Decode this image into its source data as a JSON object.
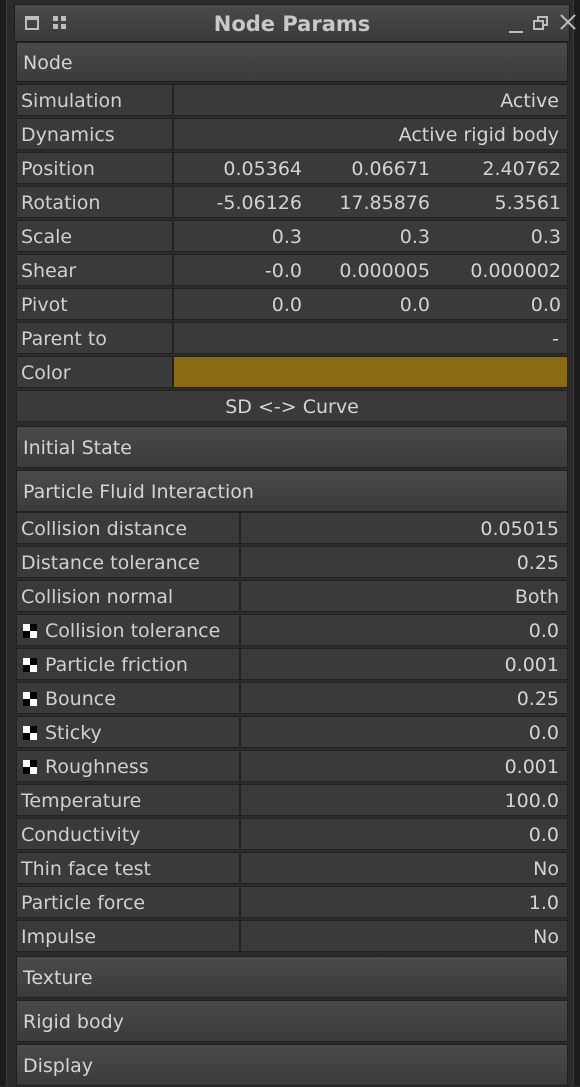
{
  "panel": {
    "title": "Node Params"
  },
  "sections": {
    "node": "Node",
    "initial_state": "Initial State",
    "particle_fluid_interaction": "Particle Fluid Interaction",
    "texture": "Texture",
    "rigid_body": "Rigid body",
    "display": "Display"
  },
  "node": {
    "simulation": {
      "label": "Simulation",
      "value": "Active"
    },
    "dynamics": {
      "label": "Dynamics",
      "value": "Active rigid body"
    },
    "position": {
      "label": "Position",
      "x": "0.05364",
      "y": "0.06671",
      "z": "2.40762"
    },
    "rotation": {
      "label": "Rotation",
      "x": "-5.06126",
      "y": "17.85876",
      "z": "5.3561"
    },
    "scale": {
      "label": "Scale",
      "x": "0.3",
      "y": "0.3",
      "z": "0.3"
    },
    "shear": {
      "label": "Shear",
      "x": "-0.0",
      "y": "0.000005",
      "z": "0.000002"
    },
    "pivot": {
      "label": "Pivot",
      "x": "0.0",
      "y": "0.0",
      "z": "0.0"
    },
    "parent_to": {
      "label": "Parent to",
      "value": "-"
    },
    "color": {
      "label": "Color",
      "hex": "#8a6a12"
    },
    "sd_curve_button": "SD <-> Curve"
  },
  "pfi": {
    "collision_distance": {
      "label": "Collision distance",
      "value": "0.05015"
    },
    "distance_tolerance": {
      "label": "Distance tolerance",
      "value": "0.25"
    },
    "collision_normal": {
      "label": "Collision normal",
      "value": "Both"
    },
    "collision_tolerance": {
      "label": "Collision tolerance",
      "value": "0.0"
    },
    "particle_friction": {
      "label": "Particle friction",
      "value": "0.001"
    },
    "bounce": {
      "label": "Bounce",
      "value": "0.25"
    },
    "sticky": {
      "label": "Sticky",
      "value": "0.0"
    },
    "roughness": {
      "label": "Roughness",
      "value": "0.001"
    },
    "temperature": {
      "label": "Temperature",
      "value": "100.0"
    },
    "conductivity": {
      "label": "Conductivity",
      "value": "0.0"
    },
    "thin_face_test": {
      "label": "Thin face test",
      "value": "No"
    },
    "particle_force": {
      "label": "Particle force",
      "value": "1.0"
    },
    "impulse": {
      "label": "Impulse",
      "value": "No"
    }
  }
}
